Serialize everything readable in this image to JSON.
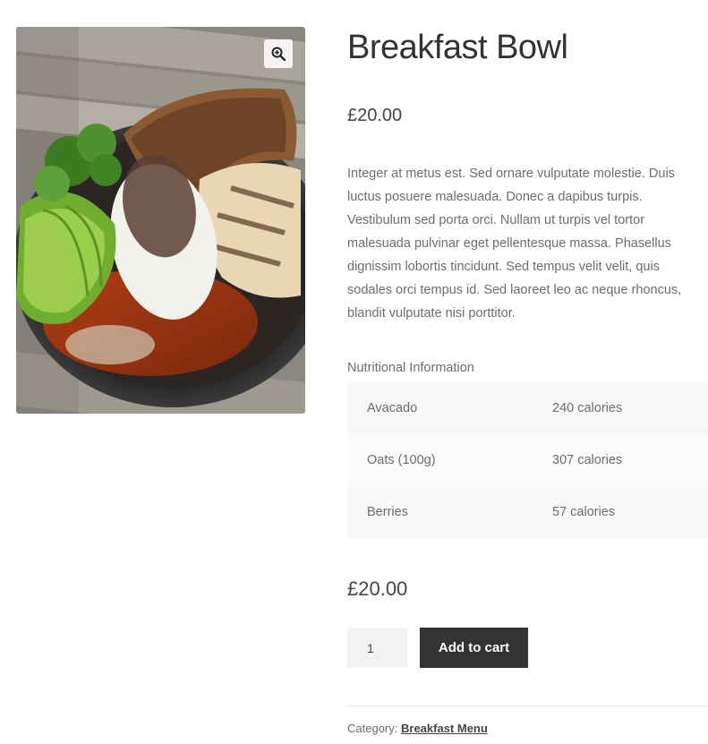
{
  "product": {
    "title": "Breakfast Bowl",
    "price": "£20.00",
    "description": "Integer at metus est. Sed ornare vulputate molestie. Duis luctus posuere malesuada. Donec a dapibus turpis. Vestibulum sed porta orci. Nullam ut turpis vel tortor malesuada pulvinar eget pellentesque massa. Phasellus dignissim lobortis tincidunt. Sed tempus velit velit, quis sodales orci tempus id. Sed laoreet leo ac neque rhoncus, blandit vulputate nisi porttitor.",
    "image_icon": "zoom-in-icon"
  },
  "nutrition": {
    "heading": "Nutritional Information",
    "rows": [
      {
        "item": "Avacado",
        "calories": "240 calories"
      },
      {
        "item": "Oats (100g)",
        "calories": "307 calories"
      },
      {
        "item": "Berries",
        "calories": "57 calories"
      }
    ]
  },
  "cart": {
    "price": "£20.00",
    "quantity": "1",
    "add_label": "Add to cart"
  },
  "meta": {
    "category_label": "Category:",
    "category_value": "Breakfast Menu"
  },
  "colors": {
    "button_bg": "#333333",
    "button_text": "#ffffff",
    "table_row": "#f8f8f8"
  }
}
